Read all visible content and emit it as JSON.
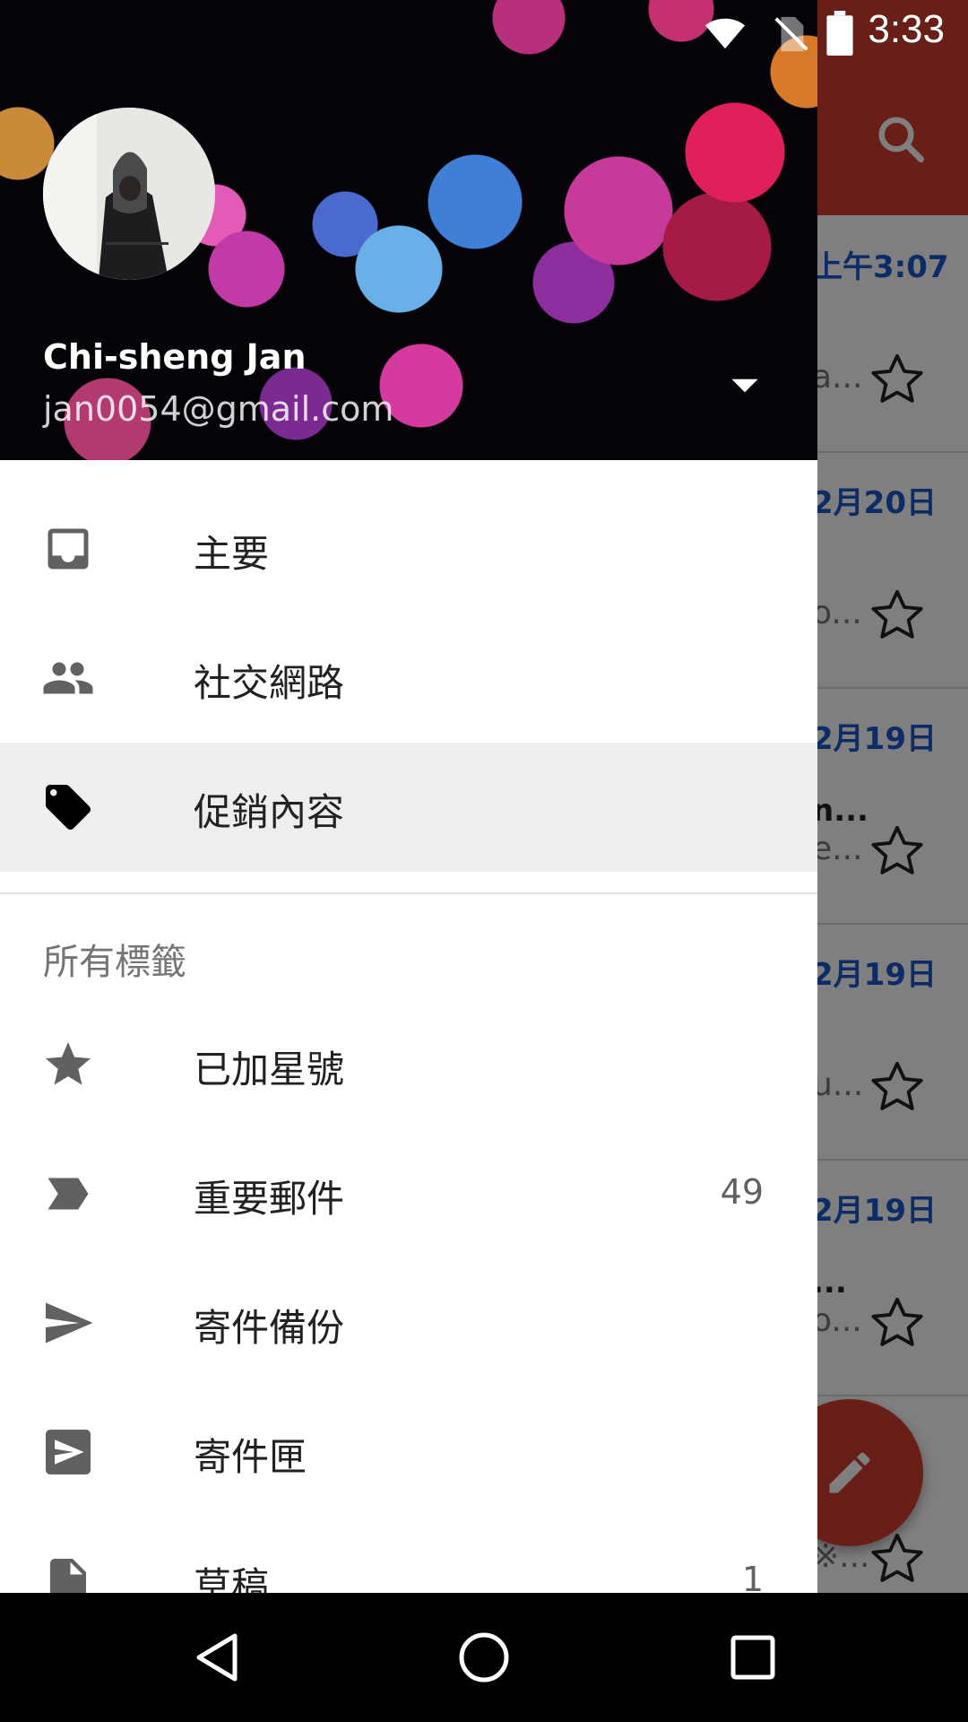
{
  "status_bar": {
    "time": "3:33"
  },
  "drawer": {
    "account": {
      "name": "Chi-sheng Jan",
      "email": "jan0054@gmail.com"
    },
    "primary_items": [
      {
        "label": "主要",
        "icon": "inbox-icon"
      },
      {
        "label": "社交網路",
        "icon": "people-icon"
      },
      {
        "label": "促銷內容",
        "icon": "tag-icon",
        "selected": true
      }
    ],
    "section_title": "所有標籤",
    "label_items": [
      {
        "label": "已加星號",
        "icon": "star-icon",
        "count": ""
      },
      {
        "label": "重要郵件",
        "icon": "important-icon",
        "count": "49"
      },
      {
        "label": "寄件備份",
        "icon": "send-icon",
        "count": ""
      },
      {
        "label": "寄件匣",
        "icon": "outbox-icon",
        "count": ""
      },
      {
        "label": "草稿",
        "icon": "draft-icon",
        "count": "1"
      }
    ]
  },
  "background_inbox": {
    "rows": [
      {
        "date": "上午3:07",
        "subject": "",
        "preview": "a..."
      },
      {
        "date": "2月20日",
        "subject": "",
        "preview": "o..."
      },
      {
        "date": "2月19日",
        "subject": "n...",
        "preview": "e..."
      },
      {
        "date": "2月19日",
        "subject": "",
        "preview": "u..."
      },
      {
        "date": "2月19日",
        "subject": "...",
        "preview": "o..."
      },
      {
        "date": "",
        "subject": "",
        "preview": "※..."
      }
    ]
  },
  "colors": {
    "appbar": "#d23f31",
    "fab": "#d23f31",
    "date_blue": "#1a56c8",
    "selected_row": "#eeeeee"
  }
}
